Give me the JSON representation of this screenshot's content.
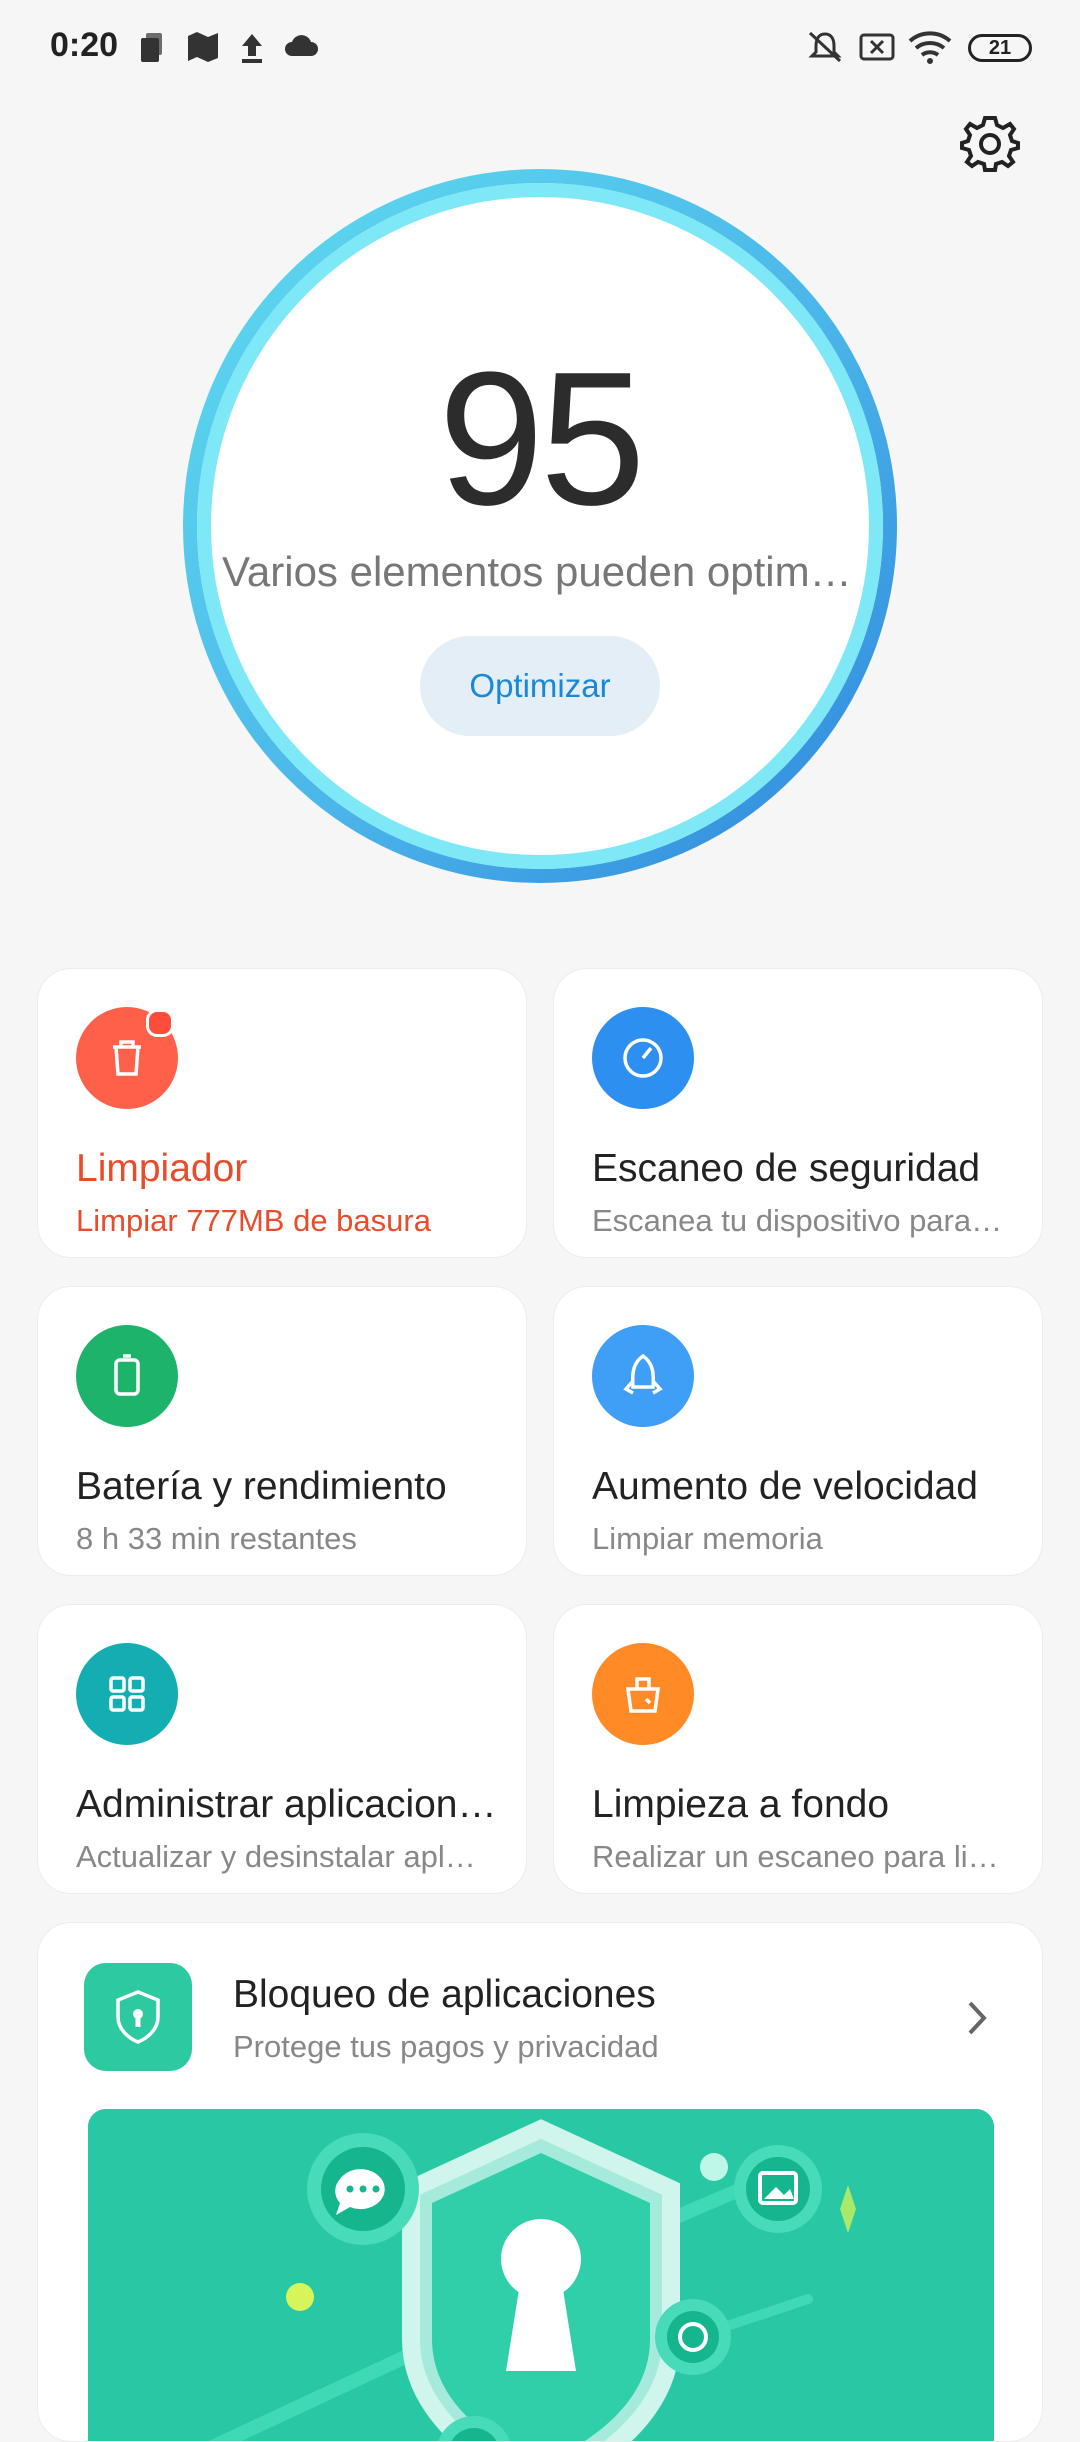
{
  "status_bar": {
    "time": "0:20",
    "battery": "21"
  },
  "score": {
    "value": "95",
    "message": "Varios elementos pueden optimi…",
    "button_label": "Optimizar"
  },
  "cards": [
    {
      "title": "Limpiador",
      "subtitle": "Limpiar 777MB de basura",
      "icon": "trash-icon",
      "color": "#ff6049"
    },
    {
      "title": "Escaneo de seguridad",
      "subtitle": "Escanea tu dispositivo para…",
      "icon": "security-scan-icon",
      "color": "#2d8ff0"
    },
    {
      "title": "Batería y rendimiento",
      "subtitle": "8 h 33 min  restantes",
      "icon": "battery-icon",
      "color": "#1eb36a"
    },
    {
      "title": "Aumento de velocidad",
      "subtitle": "Limpiar memoria",
      "icon": "rocket-icon",
      "color": "#3f9ef5"
    },
    {
      "title": "Administrar aplicacion…",
      "subtitle": "Actualizar y desinstalar apl…",
      "icon": "apps-grid-icon",
      "color": "#14aeb2"
    },
    {
      "title": "Limpieza a fondo",
      "subtitle": "Realizar un escaneo para li…",
      "icon": "deep-clean-icon",
      "color": "#ff8a26"
    }
  ],
  "app_lock": {
    "title": "Bloqueo de aplicaciones",
    "subtitle": "Protege tus pagos y privacidad",
    "icon": "shield-lock-icon"
  }
}
